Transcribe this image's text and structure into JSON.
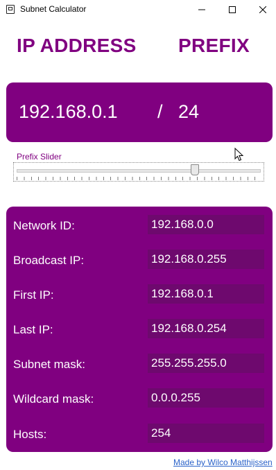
{
  "window": {
    "title": "Subnet Calculator"
  },
  "headings": {
    "ip": "IP ADDRESS",
    "prefix": "PREFIX"
  },
  "ip_panel": {
    "ip_address": "192.168.0.1",
    "separator": "/",
    "prefix": "24"
  },
  "slider": {
    "label": "Prefix Slider",
    "value": 24,
    "min": 0,
    "max": 32
  },
  "results": [
    {
      "label": "Network ID:",
      "value": "192.168.0.0"
    },
    {
      "label": "Broadcast IP:",
      "value": "192.168.0.255"
    },
    {
      "label": "First IP:",
      "value": "192.168.0.1"
    },
    {
      "label": "Last IP:",
      "value": "192.168.0.254"
    },
    {
      "label": "Subnet mask:",
      "value": "255.255.255.0"
    },
    {
      "label": "Wildcard mask:",
      "value": "0.0.0.255"
    },
    {
      "label": "Hosts:",
      "value": "254"
    }
  ],
  "footer": {
    "credit_link": "Made by Wilco Matthijssen"
  },
  "colors": {
    "accent": "#800080",
    "value_box": "#6e096e",
    "link": "#2a62c9"
  }
}
